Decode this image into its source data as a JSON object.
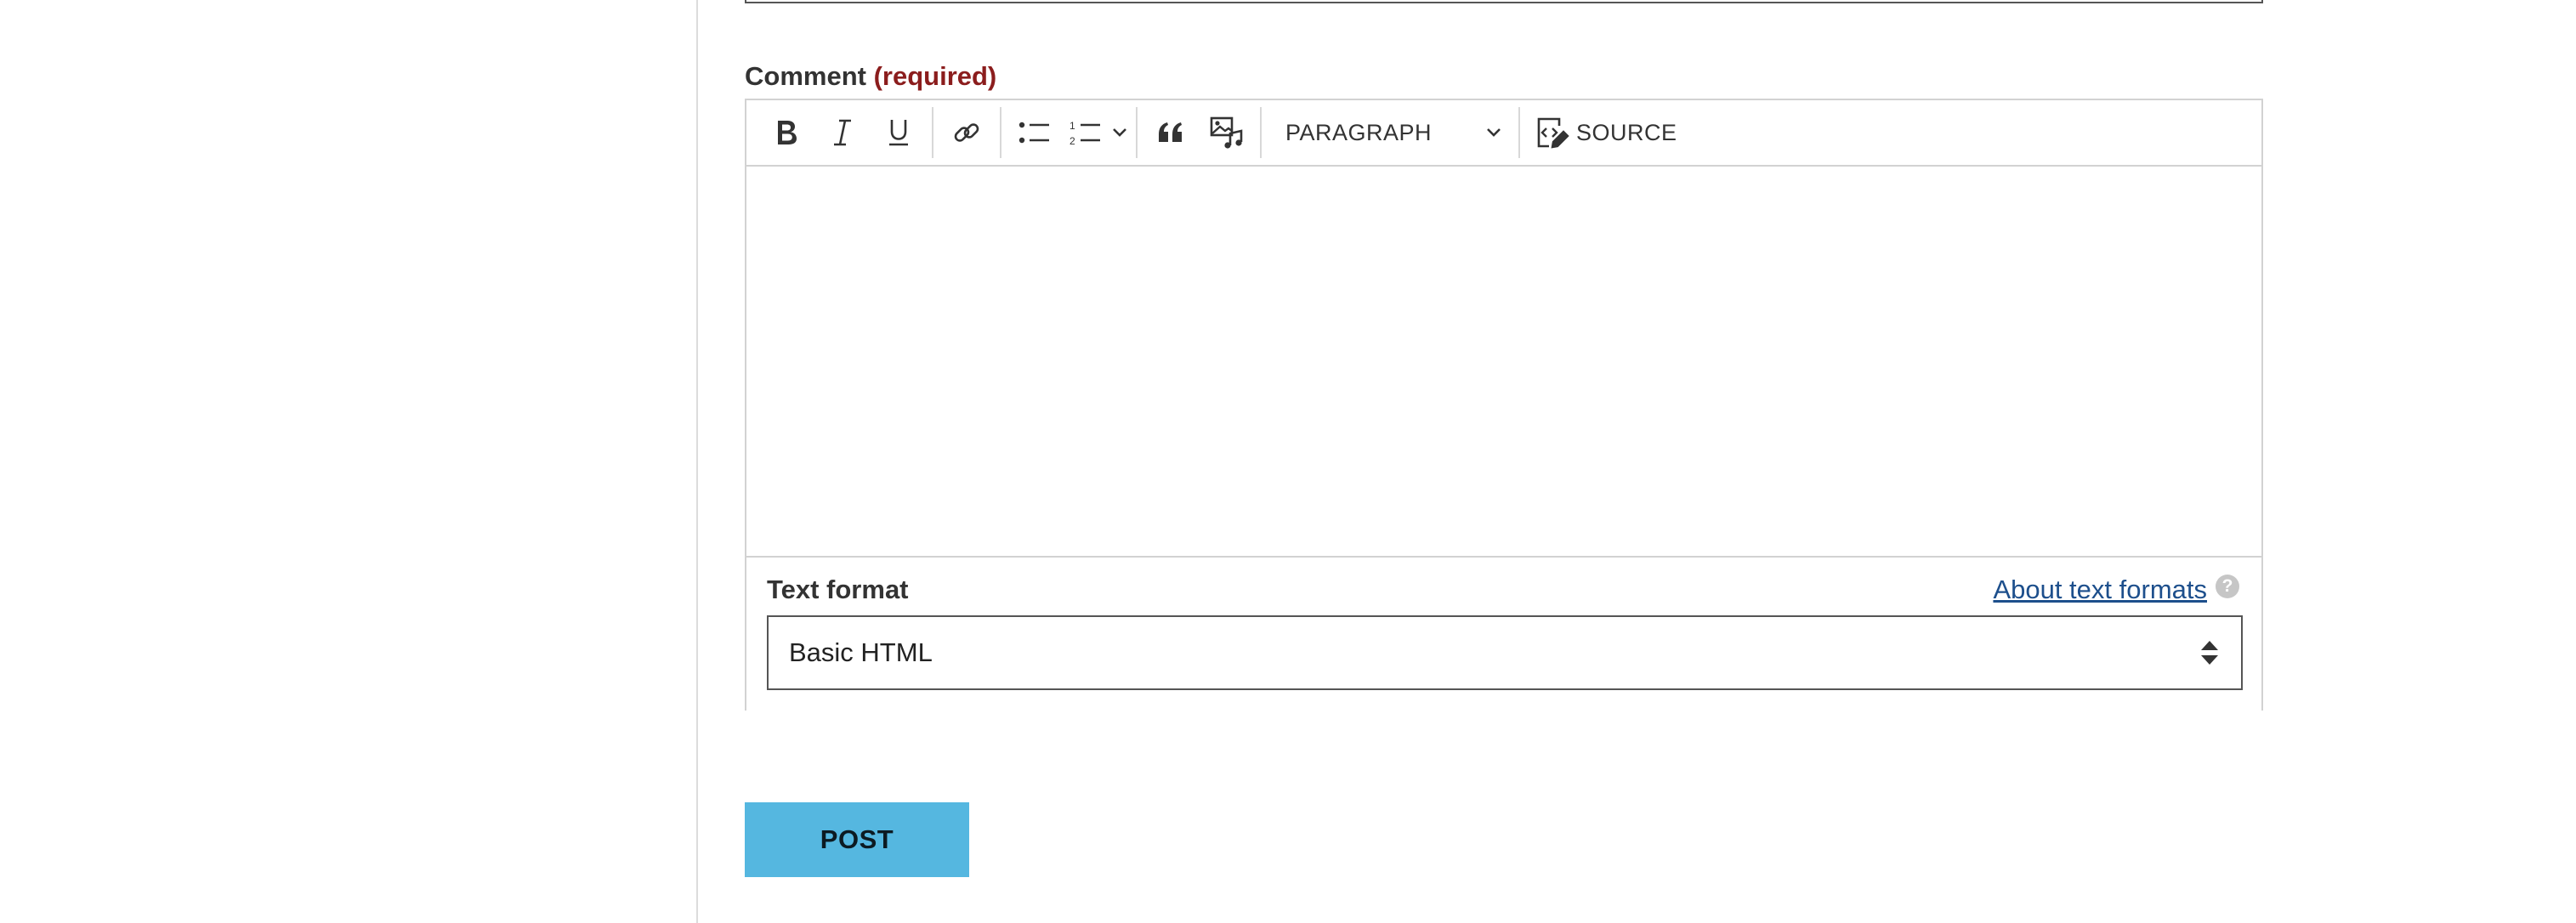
{
  "comment": {
    "label": "Comment",
    "required_label": "(required)"
  },
  "toolbar": {
    "bold_icon": "bold-icon",
    "italic_icon": "italic-icon",
    "underline_icon": "underline-icon",
    "link_icon": "link-icon",
    "bulleted_list_icon": "bulleted-list-icon",
    "numbered_list_icon": "numbered-list-icon",
    "blockquote_icon": "blockquote-icon",
    "media_icon": "media-icon",
    "heading_dropdown": "PARAGRAPH",
    "source_label": "SOURCE"
  },
  "editor": {
    "content": ""
  },
  "text_format": {
    "label": "Text format",
    "about_link": "About text formats",
    "help_icon": "?",
    "selected": "Basic HTML"
  },
  "actions": {
    "post_label": "POST",
    "post_color": "#55b7e0"
  },
  "colors": {
    "required": "#8b1d1d",
    "link": "#1d4f8c"
  }
}
